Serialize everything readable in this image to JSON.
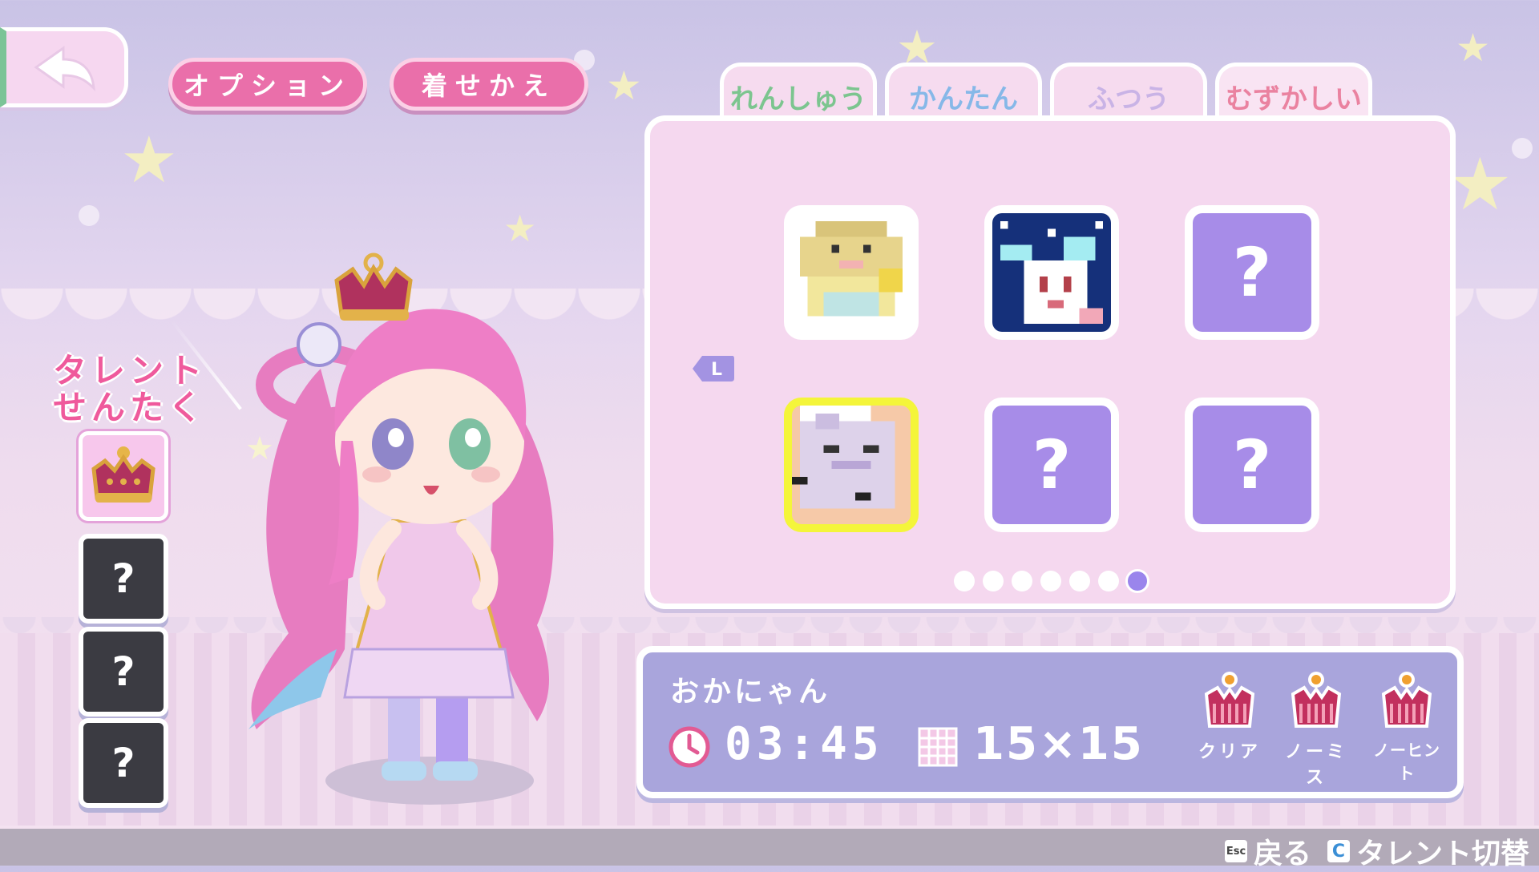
{
  "header": {
    "back_icon": "back-arrow-icon",
    "options_label": "オプション",
    "dressup_label": "着せかえ"
  },
  "talent": {
    "title_line1": "タレント",
    "title_line2": "せんたく",
    "slots": [
      {
        "state": "unlocked",
        "icon": "crown-icon"
      },
      {
        "state": "locked",
        "label": "?"
      },
      {
        "state": "locked",
        "label": "?"
      },
      {
        "state": "locked",
        "label": "?"
      }
    ]
  },
  "tabs": [
    {
      "label": "れんしゅう",
      "color": "#7cc58f",
      "active": false
    },
    {
      "label": "かんたん",
      "color": "#86b8e8",
      "active": false
    },
    {
      "label": "ふつう",
      "color": "#c9b3e6",
      "active": false
    },
    {
      "label": "むずかしい",
      "color": "#ea82a0",
      "active": true
    }
  ],
  "puzzles": {
    "page_indicator_key": "L",
    "cells": [
      {
        "state": "solved",
        "icon": "pixel-dog-icon"
      },
      {
        "state": "solved",
        "icon": "pixel-rabbit-icon"
      },
      {
        "state": "locked",
        "label": "?"
      },
      {
        "state": "solved",
        "icon": "pixel-cat-icon",
        "selected": true
      },
      {
        "state": "locked",
        "label": "?"
      },
      {
        "state": "locked",
        "label": "?"
      }
    ],
    "pages_total": 7,
    "current_page": 7
  },
  "info": {
    "name": "おかにゃん",
    "time": "03:45",
    "size": "15×15",
    "awards": [
      {
        "label": "クリア",
        "icon": "crown-award-icon"
      },
      {
        "label": "ノーミス",
        "icon": "crown-award-icon"
      },
      {
        "label": "ノーヒント",
        "icon": "crown-award-icon"
      }
    ]
  },
  "footer": {
    "back_key": "Esc",
    "back_label": "戻る",
    "switch_key": "C",
    "switch_label": "タレント切替"
  },
  "colors": {
    "accent_pink": "#ea6faa",
    "panel_pink": "#f5d8ef",
    "locked_purple": "#a78ce8",
    "info_purple": "#a9a5dc",
    "selection_yellow": "#f4f53a"
  }
}
